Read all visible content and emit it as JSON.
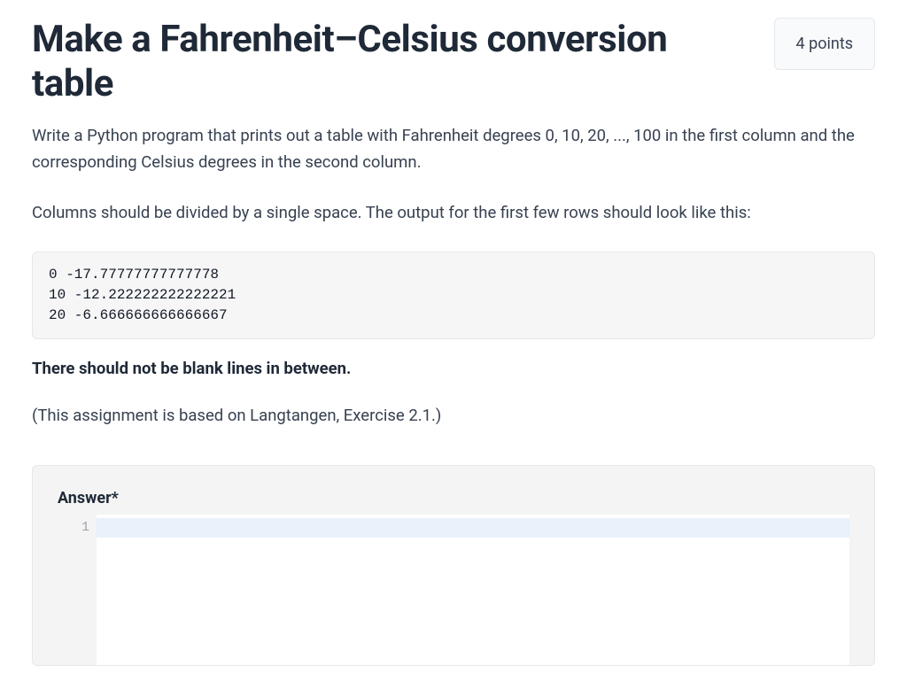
{
  "header": {
    "title": "Make a Fahrenheit–Celsius conversion table",
    "points_label": "4 points"
  },
  "description": {
    "para1": "Write a Python program that prints out a table with Fahrenheit degrees 0, 10, 20, ..., 100 in the first column and the corresponding Celsius degrees in the second column.",
    "para2": "Columns should be divided by a single space. The output for the first few rows should look like this:",
    "code_sample": "0 -17.77777777777778\n10 -12.222222222222221\n20 -6.666666666666667",
    "bold_note": "There should not be blank lines in between.",
    "attribution": "(This assignment is based on Langtangen, Exercise 2.1.)"
  },
  "answer": {
    "label": "Answer*",
    "line_numbers": [
      "1"
    ],
    "value": ""
  }
}
